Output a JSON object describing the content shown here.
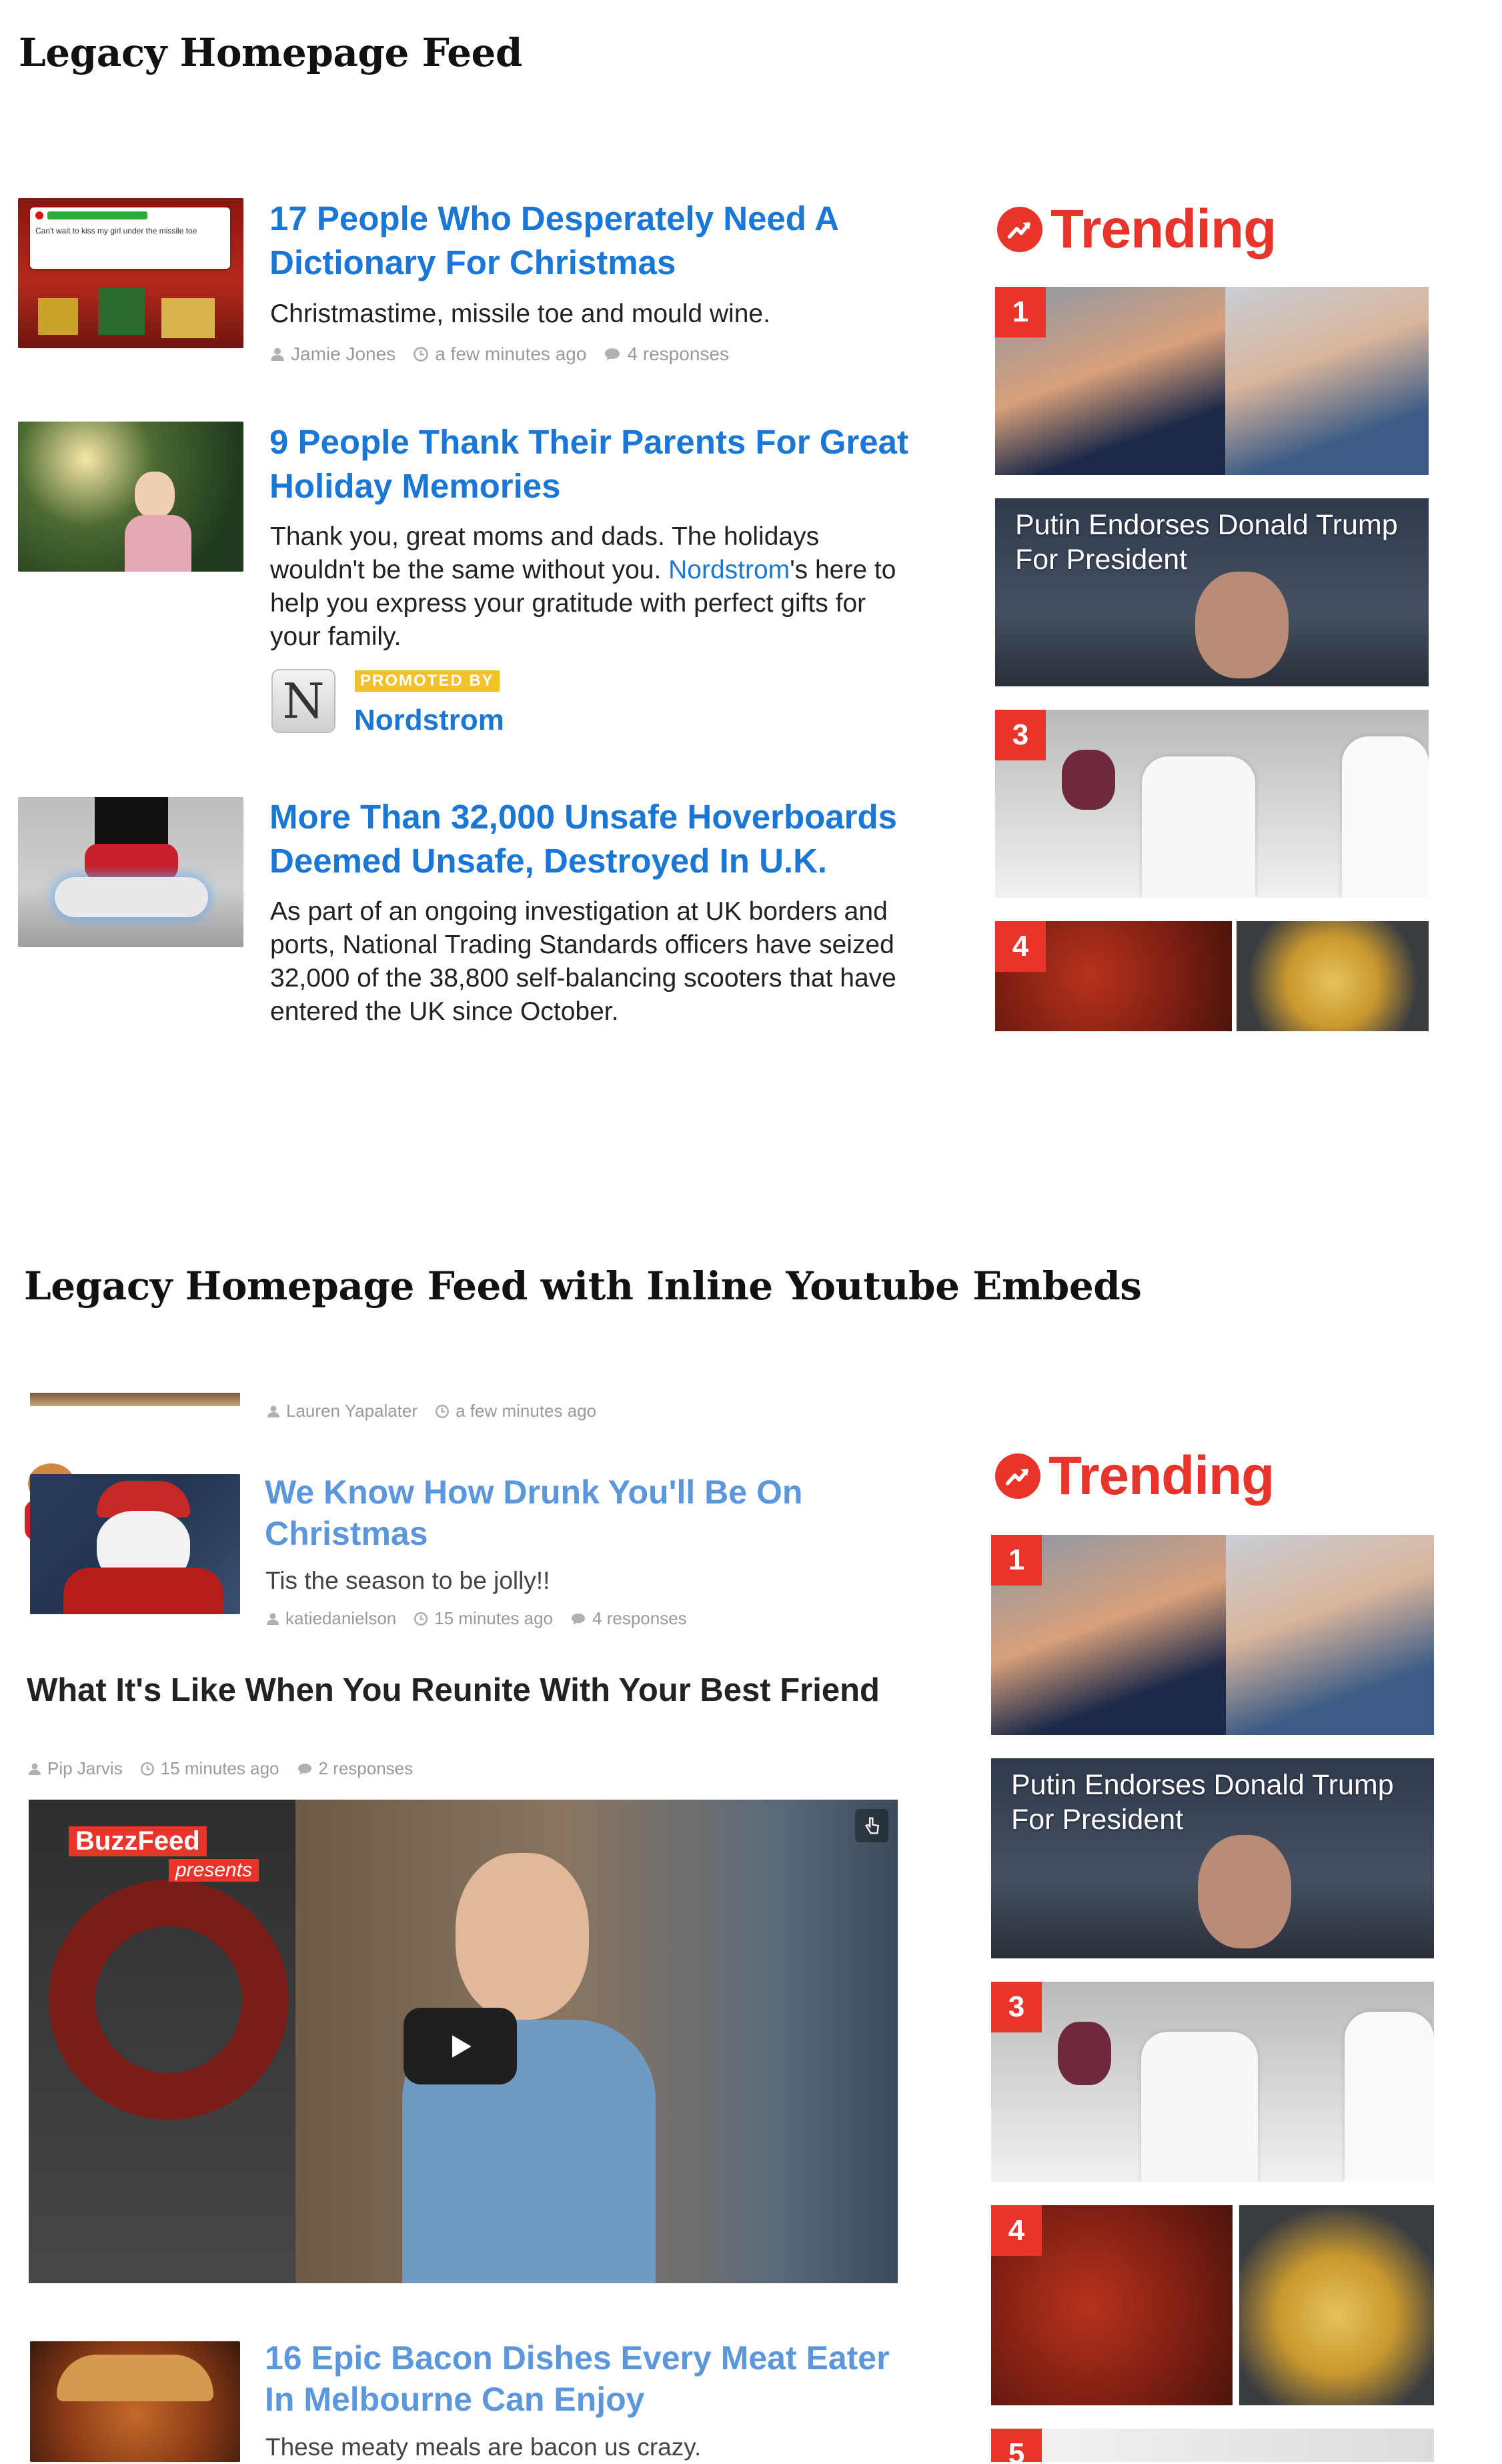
{
  "section1": {
    "title": "Legacy Homepage Feed",
    "posts": [
      {
        "headline_l1": "17 People Who Desperately Need A",
        "headline_l2": "Dictionary For Christmas",
        "description": "Christmastime, missile toe and mould wine.",
        "author": "Jamie Jones",
        "time": "a few minutes ago",
        "responses": "4 responses",
        "thumb_caption": "Can't wait to kiss my girl under the missile toe"
      },
      {
        "headline_l1": "9 People Thank Their Parents For Great",
        "headline_l2": "Holiday Memories",
        "desc_l1": "Thank you, great moms and dads. The holidays",
        "desc_l2_pre": "wouldn't be the same without you. ",
        "desc_l2_link": "Nordstrom",
        "desc_l2_post": "'s here to",
        "desc_l3": "help you express your gratitude with perfect gifts for",
        "desc_l4": "your family.",
        "promo_label": "PROMOTED BY",
        "promo_name": "Nordstrom",
        "promo_letter": "N"
      },
      {
        "headline_l1": "More Than 32,000 Unsafe Hoverboards",
        "headline_l2": "Deemed Unsafe, Destroyed In U.K.",
        "desc_l1": "As part of an ongoing investigation at UK borders and",
        "desc_l2": "ports, National Trading Standards officers have seized",
        "desc_l3": "32,000 of the 38,800 self-balancing scooters that have",
        "desc_l4": "entered the UK since October."
      }
    ],
    "trending": {
      "label": "Trending",
      "items": [
        {
          "num": "1"
        },
        {
          "caption_l1": "Putin Endorses Donald Trump",
          "caption_l2": "For President"
        },
        {
          "num": "3"
        },
        {
          "num": "4"
        }
      ]
    }
  },
  "section2": {
    "title": "Legacy Homepage Feed with Inline Youtube Embeds",
    "top_meta": {
      "author": "Lauren Yapalater",
      "time": "a few minutes ago"
    },
    "post1": {
      "headline_l1": "We Know How Drunk You'll Be On",
      "headline_l2": "Christmas",
      "description": "Tis the season to be jolly!!",
      "author": "katiedanielson",
      "time": "15 minutes ago",
      "responses": "4 responses"
    },
    "video_post": {
      "headline": "What It's Like When You Reunite With Your Best Friend",
      "author": "Pip Jarvis",
      "time": "15 minutes ago",
      "responses": "2 responses",
      "brand_l1": "BuzzFeed",
      "brand_l2": "presents"
    },
    "post3": {
      "headline_l1": "16 Epic Bacon Dishes Every Meat Eater",
      "headline_l2": "In Melbourne Can Enjoy",
      "description": "These meaty meals are bacon us crazy."
    },
    "trending": {
      "label": "Trending",
      "items": [
        {
          "num": "1"
        },
        {
          "caption_l1": "Putin Endorses Donald Trump",
          "caption_l2": "For President"
        },
        {
          "num": "3"
        },
        {
          "num": "4"
        },
        {
          "num": "5"
        }
      ]
    }
  },
  "colors": {
    "link": "#1a77d6",
    "trending_red": "#e8342a",
    "promo_yellow": "#f2c12e",
    "meta_gray": "#9a9a9a"
  }
}
